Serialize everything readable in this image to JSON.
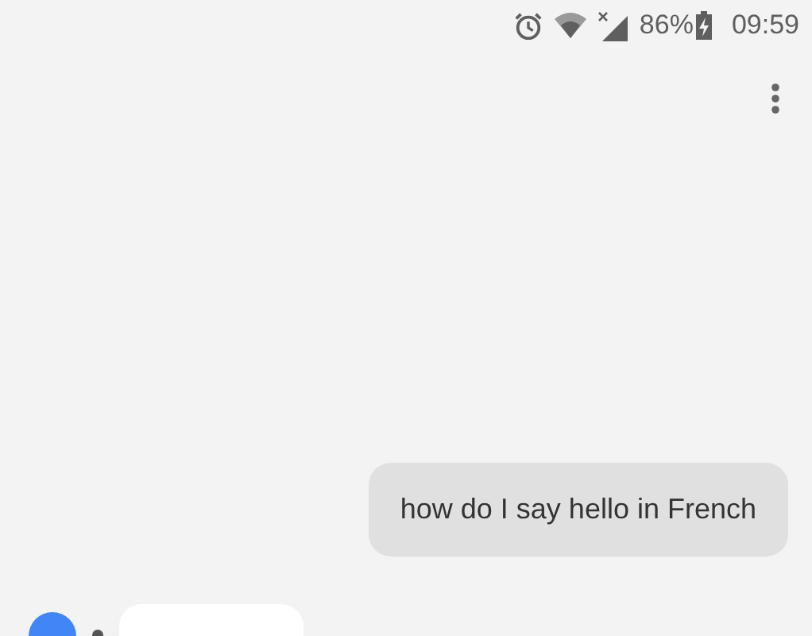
{
  "status_bar": {
    "battery": "86%",
    "time": "09:59"
  },
  "messages": [
    {
      "kind": "user",
      "text": "how do I say hello in French"
    },
    {
      "kind": "assistant"
    }
  ]
}
